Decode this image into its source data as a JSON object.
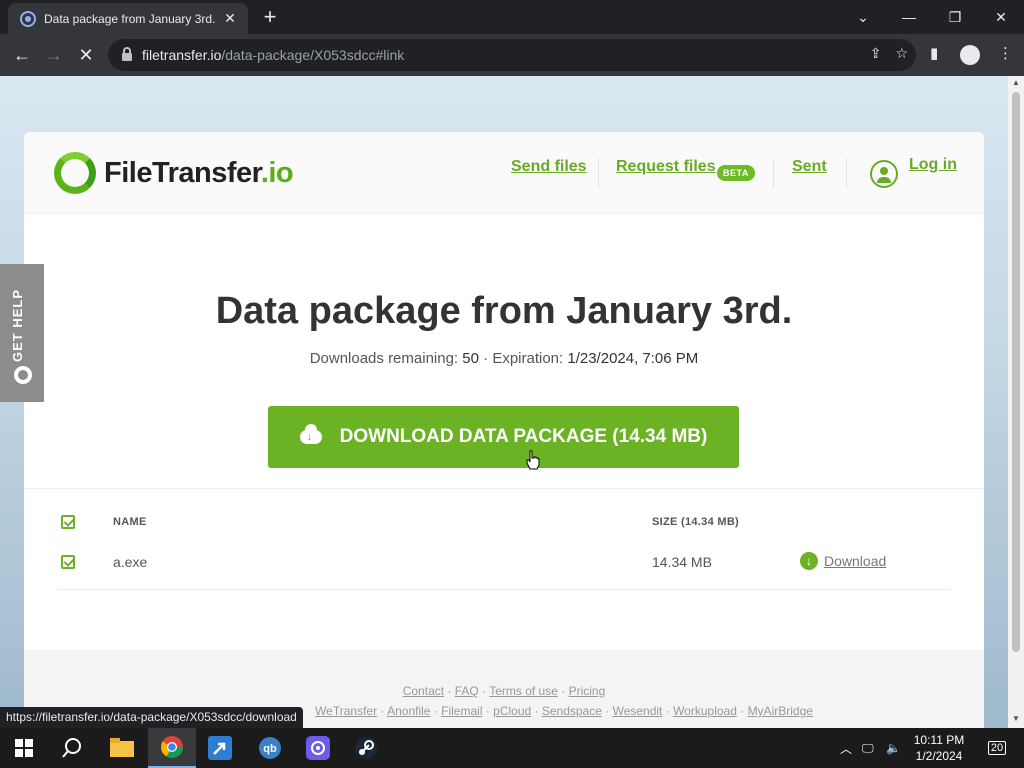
{
  "browser": {
    "tab_title": "Data package from January 3rd.",
    "tab_close": "✕",
    "new_tab": "+",
    "url_host": "filetransfer.io",
    "url_path": "/data-package/X053sdcc#link",
    "window_controls": [
      "⌄",
      "—",
      "❐",
      "✕"
    ],
    "status_url": "https://filetransfer.io/data-package/X053sdcc/download"
  },
  "site": {
    "logo_main": "FileTransfer",
    "logo_accent": ".io",
    "nav": {
      "send_files": "Send files",
      "request_files": "Request files",
      "beta": "BETA",
      "sent": "Sent",
      "login": "Log in"
    },
    "get_help": "GET HELP"
  },
  "package": {
    "title": "Data package from January 3rd.",
    "downloads_label": "Downloads remaining:",
    "downloads_value": "50",
    "separator": "·",
    "expiration_label": "Expiration:",
    "expiration_value": "1/23/2024, 7:06 PM",
    "download_button": "DOWNLOAD DATA PACKAGE (14.34 MB)"
  },
  "files_table": {
    "columns": {
      "name": "NAME",
      "size": "SIZE (14.34 MB)"
    },
    "rows": [
      {
        "name": "a.exe",
        "size": "14.34 MB",
        "action": "Download"
      }
    ]
  },
  "footer": {
    "row1": [
      "Contact",
      "FAQ",
      "Terms of use",
      "Pricing"
    ],
    "row2": [
      "WeTransfer",
      "Anonfile",
      "Filemail",
      "pCloud",
      "Sendspace",
      "Wesendit",
      "Workupload",
      "MyAirBridge"
    ]
  },
  "taskbar": {
    "time": "10:11 PM",
    "date": "1/2/2024",
    "notifications": "20"
  },
  "colors": {
    "accent": "#6bb325",
    "chrome_dark": "#202124",
    "chrome_toolbar": "#35363a"
  }
}
